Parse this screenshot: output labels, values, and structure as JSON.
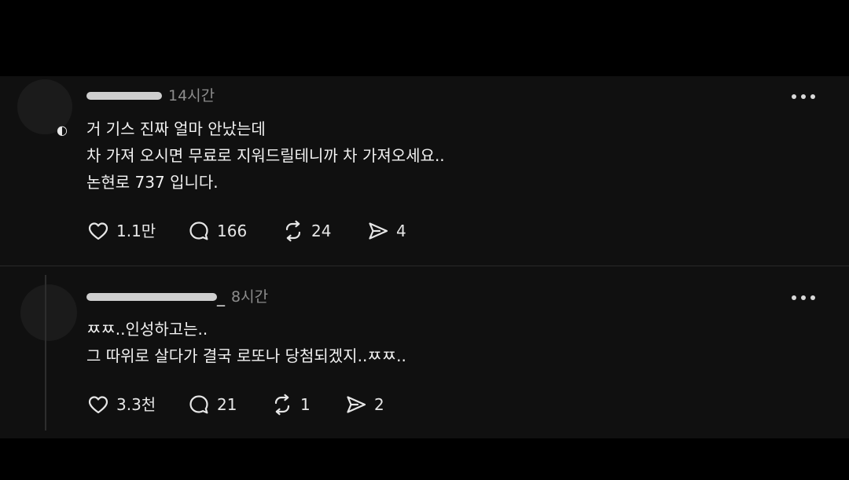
{
  "thread": {
    "posts": [
      {
        "username_tail": "",
        "time": "14시간",
        "body_lines": [
          "거 기스 진짜 얼마 안났는데",
          "차 가져 오시면 무료로 지워드릴테니까 차 가져오세요..",
          "논현로 737 입니다."
        ],
        "likes": "1.1만",
        "replies": "166",
        "reposts": "24",
        "shares": "4"
      },
      {
        "username_tail": "_",
        "time": "8시간",
        "body_lines": [
          "ㅉㅉ..인성하고는..",
          "그 따위로 살다가 결국 로또나 당첨되겠지..ㅉㅉ.."
        ],
        "likes": "3.3천",
        "replies": "21",
        "reposts": "1",
        "shares": "2"
      }
    ]
  },
  "icons": {
    "like": "heart-icon",
    "reply": "reply-bubble-icon",
    "repost": "repost-icon",
    "share": "share-send-icon",
    "more": "more-options-icon"
  },
  "colors": {
    "background": "#000000",
    "panel": "#101010",
    "text": "#f2f2f2",
    "muted": "#8d8d8d",
    "divider": "#2a2a2a"
  }
}
